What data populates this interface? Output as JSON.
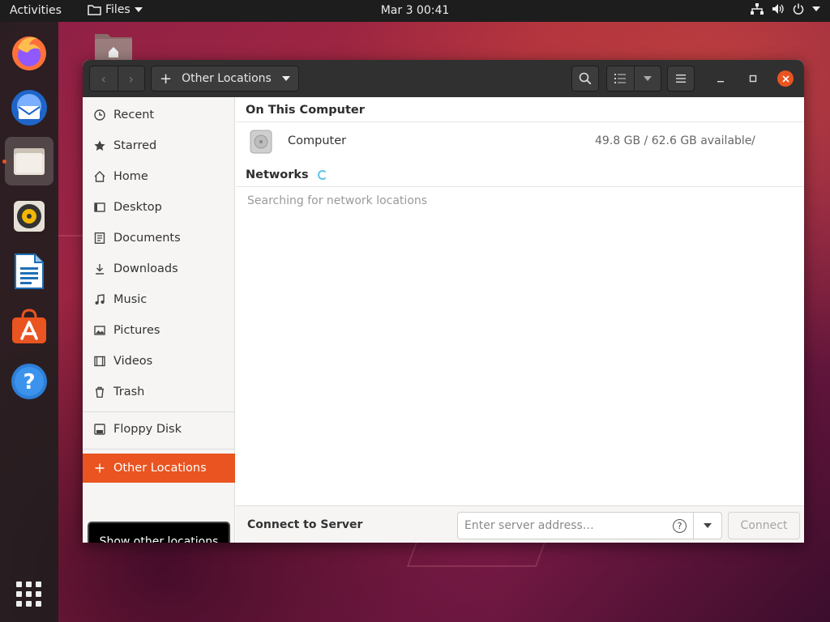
{
  "topbar": {
    "activities": "Activities",
    "app_name": "Files",
    "datetime": "Mar 3  00:41"
  },
  "dock": {
    "apps": [
      "firefox-icon",
      "thunderbird-icon",
      "files-icon",
      "rhythmbox-icon",
      "libreoffice-writer-icon",
      "ubuntu-software-icon",
      "help-icon"
    ],
    "active": "files-icon"
  },
  "headerbar": {
    "location_label": "Other Locations",
    "location_icon": "+"
  },
  "sidebar": {
    "items": [
      {
        "label": "Recent",
        "icon": "clock-icon"
      },
      {
        "label": "Starred",
        "icon": "star-icon"
      },
      {
        "label": "Home",
        "icon": "home-icon"
      },
      {
        "label": "Desktop",
        "icon": "desktop-icon"
      },
      {
        "label": "Documents",
        "icon": "document-icon"
      },
      {
        "label": "Downloads",
        "icon": "download-icon"
      },
      {
        "label": "Music",
        "icon": "music-icon"
      },
      {
        "label": "Pictures",
        "icon": "picture-icon"
      },
      {
        "label": "Videos",
        "icon": "video-icon"
      },
      {
        "label": "Trash",
        "icon": "trash-icon"
      }
    ],
    "devices": [
      {
        "label": "Floppy Disk",
        "icon": "floppy-icon"
      }
    ],
    "other_locations": "Other Locations",
    "tooltip": "Show other locations"
  },
  "main": {
    "on_this_computer": "On This Computer",
    "computer": {
      "name": "Computer",
      "space": "49.8 GB / 62.6 GB available",
      "path": "/"
    },
    "networks": "Networks",
    "searching": "Searching for network locations"
  },
  "connect": {
    "label": "Connect to Server",
    "placeholder": "Enter server address…",
    "button": "Connect"
  },
  "colors": {
    "accent": "#e95420",
    "topbar": "#1d1d1d",
    "headerbar": "#303030",
    "sidebar": "#f6f5f4"
  }
}
